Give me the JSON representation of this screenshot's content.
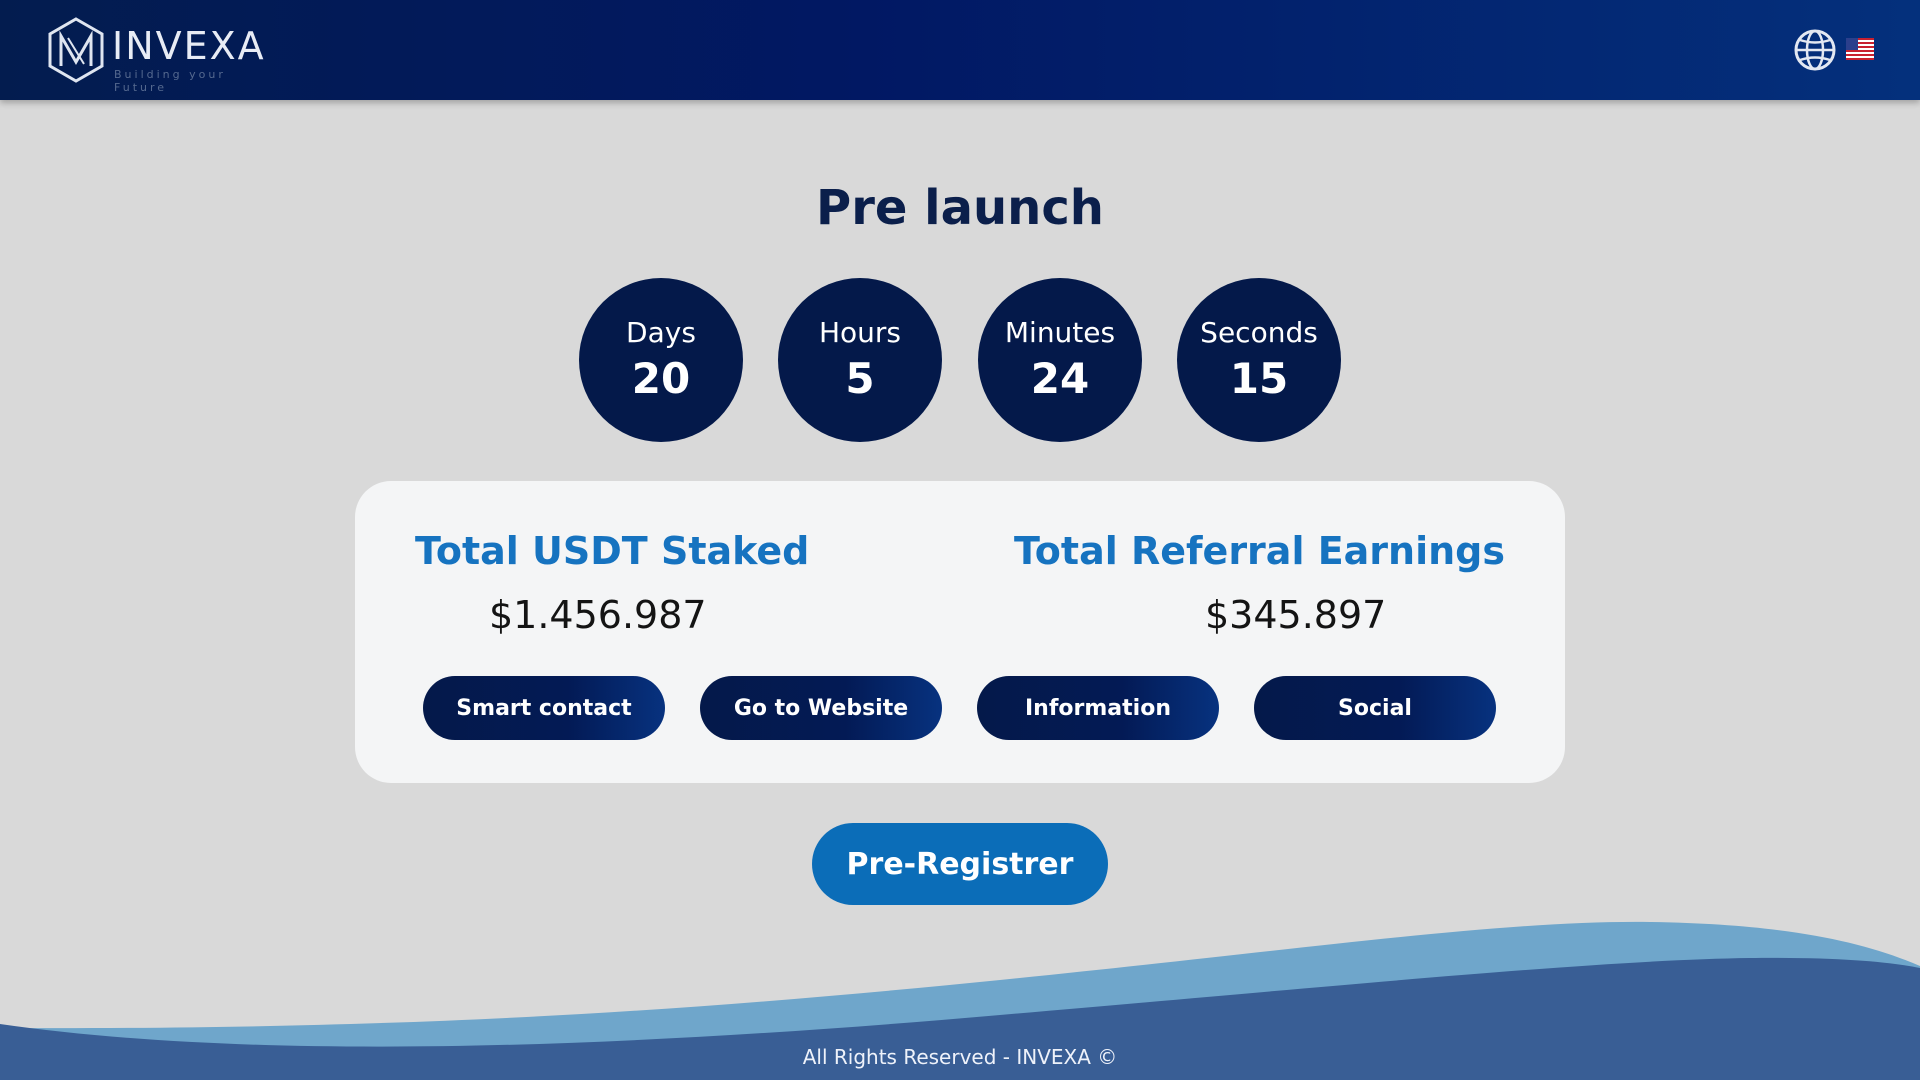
{
  "header": {
    "logo_text": "INVEXA",
    "logo_tagline": "Building your Future",
    "language_icon": "globe-icon",
    "language_flag": "us-flag-icon"
  },
  "main": {
    "title": "Pre launch",
    "countdown": [
      {
        "label": "Days",
        "value": "20"
      },
      {
        "label": "Hours",
        "value": "5"
      },
      {
        "label": "Minutes",
        "value": "24"
      },
      {
        "label": "Seconds",
        "value": "15"
      }
    ],
    "stats": {
      "staked_title": "Total USDT Staked",
      "staked_value": "$1.456.987",
      "referral_title": "Total Referral Earnings",
      "referral_value": "$345.897"
    },
    "buttons": [
      {
        "label": "Smart contact"
      },
      {
        "label": "Go to Website"
      },
      {
        "label": "Information"
      },
      {
        "label": "Social"
      }
    ],
    "cta_label": "Pre-Registrer"
  },
  "footer": {
    "text": "All Rights Reserved - INVEXA ©"
  },
  "colors": {
    "header_dark": "#011863",
    "navy": "#04194a",
    "accent_blue": "#1673c0",
    "cta_blue": "#0b6db8",
    "wave_light": "#6fa6cb",
    "wave_dark": "#395e95",
    "background": "#d9d9d9"
  }
}
